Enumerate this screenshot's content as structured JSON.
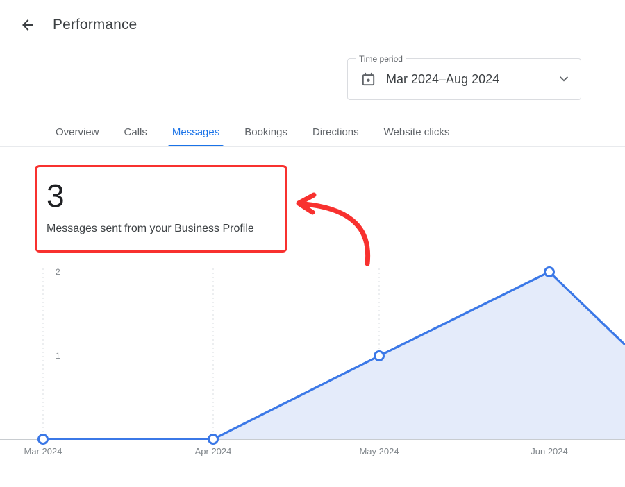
{
  "header": {
    "back_icon": "arrow-left-icon",
    "title": "Performance"
  },
  "time_period": {
    "legend": "Time period",
    "value": "Mar 2024–Aug 2024",
    "calendar_icon": "calendar-icon",
    "dropdown_icon": "chevron-down-icon"
  },
  "tabs": [
    {
      "label": "Overview",
      "active": false
    },
    {
      "label": "Calls",
      "active": false
    },
    {
      "label": "Messages",
      "active": true
    },
    {
      "label": "Bookings",
      "active": false
    },
    {
      "label": "Directions",
      "active": false
    },
    {
      "label": "Website clicks",
      "active": false
    }
  ],
  "metric": {
    "value": "3",
    "label": "Messages sent from your Business Profile"
  },
  "annotation": {
    "type": "red-curved-arrow",
    "color": "#f8312f",
    "points_to": "metric-card"
  },
  "colors": {
    "accent_blue": "#1a73e8",
    "line": "#3b78e7",
    "area_fill": "#e4ebfa",
    "annotation_red": "#f8312f",
    "grid": "#dadce0",
    "axis_text": "#80868b"
  },
  "chart_data": {
    "type": "area",
    "title": "",
    "xlabel": "",
    "ylabel": "",
    "categories": [
      "Mar 2024",
      "Apr 2024",
      "May 2024",
      "Jun 2024"
    ],
    "values": [
      0,
      0,
      1,
      2
    ],
    "yticks": [
      1,
      2
    ],
    "ylim": [
      0,
      2.2
    ],
    "grid": "vertical-dotted",
    "legend": "none",
    "note": "Series continues past the right edge of the viewport, descending from Jun 2024 (2) toward the clipped Jul 2024 point."
  }
}
